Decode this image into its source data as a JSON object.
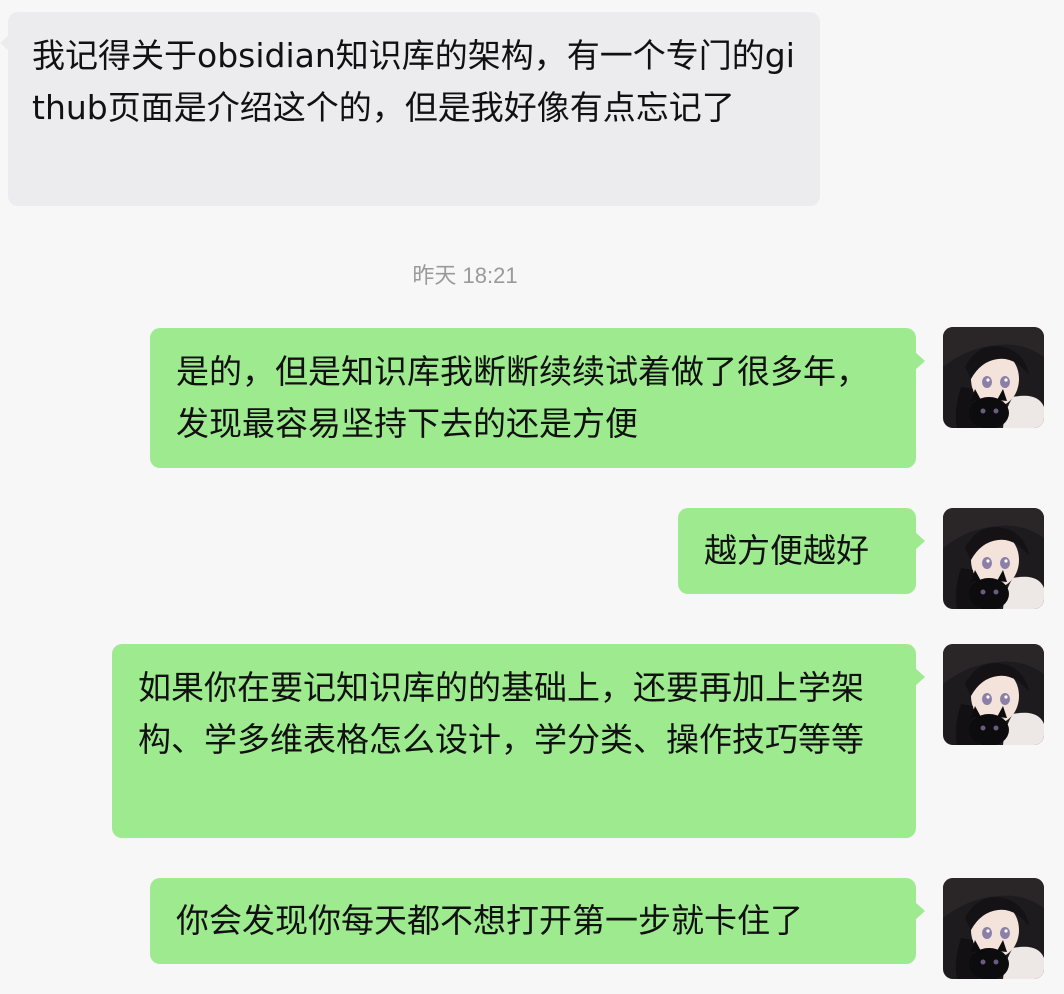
{
  "conversation": {
    "messages": [
      {
        "id": "m1",
        "sender": "other",
        "text": "我记得关于obsidian知识库的架构，有一个专门的github页面是介绍这个的，但是我好像有点忘记了"
      },
      {
        "id": "m2",
        "sender": "me",
        "text": "是的，但是知识库我断断续续试着做了很多年，发现最容易坚持下去的还是方便"
      },
      {
        "id": "m3",
        "sender": "me",
        "text": "越方便越好"
      },
      {
        "id": "m4",
        "sender": "me",
        "text": "如果你在要记知识库的的基础上，还要再加上学架构、学多维表格怎么设计，学分类、操作技巧等等"
      },
      {
        "id": "m5",
        "sender": "me",
        "text": "你会发现你每天都不想打开第一步就卡住了"
      }
    ],
    "timestamp": "昨天 18:21"
  },
  "colors": {
    "background": "#f7f7f7",
    "incoming_bubble": "#ececee",
    "outgoing_bubble": "#9eea8e",
    "timestamp_text": "#9a9a9a"
  },
  "avatar": {
    "icon": "anime-girl-with-black-cat-avatar"
  }
}
